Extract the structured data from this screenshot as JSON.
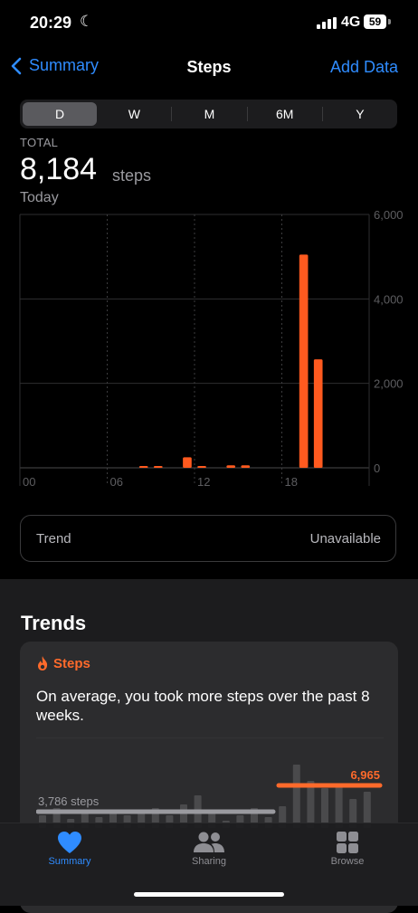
{
  "status": {
    "time": "20:29",
    "network": "4G",
    "battery": "59"
  },
  "nav": {
    "back_label": "Summary",
    "title": "Steps",
    "action_label": "Add Data"
  },
  "ranges": [
    "D",
    "W",
    "M",
    "6M",
    "Y"
  ],
  "summary": {
    "total_label": "TOTAL",
    "total_value": "8,184",
    "unit": "steps",
    "period": "Today"
  },
  "chart_data": {
    "type": "bar",
    "x_tick_labels": [
      "00",
      "06",
      "12",
      "18"
    ],
    "y_tick_labels": [
      "6,000",
      "4,000",
      "2,000",
      "0"
    ],
    "ylim": [
      0,
      6000
    ],
    "x_unit": "hour",
    "bars": [
      {
        "hour": 8,
        "value": 20
      },
      {
        "hour": 9,
        "value": 40
      },
      {
        "hour": 11,
        "value": 250
      },
      {
        "hour": 12,
        "value": 40
      },
      {
        "hour": 14,
        "value": 60
      },
      {
        "hour": 15,
        "value": 60
      },
      {
        "hour": 19,
        "value": 5050
      },
      {
        "hour": 20,
        "value": 2570
      }
    ],
    "color": "#ff5a1f"
  },
  "trend_row": {
    "label": "Trend",
    "value": "Unavailable"
  },
  "trends": {
    "section_title": "Trends",
    "card_title": "Steps",
    "message": "On average, you took more steps over the past 8 weeks.",
    "baseline_label": "3,786 steps",
    "recent_label": "6,965",
    "accent": "#ff6a2b"
  },
  "tabs": [
    {
      "label": "Summary",
      "icon": "heart-icon",
      "active": true
    },
    {
      "label": "Sharing",
      "icon": "people-icon",
      "active": false
    },
    {
      "label": "Browse",
      "icon": "grid-icon",
      "active": false
    }
  ],
  "colors": {
    "accent_blue": "#2f8cff",
    "steps_orange": "#ff5a1f"
  }
}
